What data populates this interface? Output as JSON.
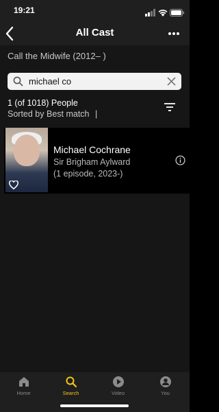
{
  "status": {
    "time": "19:21"
  },
  "header": {
    "title": "All Cast"
  },
  "show": {
    "title": "Call the Midwife (2012– )"
  },
  "search": {
    "value": "michael co"
  },
  "results": {
    "count_text": "1 (of 1018) People",
    "sort_text": "Sorted by Best match",
    "sort_separator": "|",
    "items": [
      {
        "name": "Michael Cochrane",
        "role": "Sir Brigham Aylward",
        "episodes": "(1 episode, 2023-)"
      }
    ]
  },
  "tabs": [
    {
      "label": "Home",
      "icon": "home-icon",
      "active": false
    },
    {
      "label": "Search",
      "icon": "search-icon",
      "active": true
    },
    {
      "label": "Video",
      "icon": "play-icon",
      "active": false
    },
    {
      "label": "You",
      "icon": "user-icon",
      "active": false
    }
  ],
  "colors": {
    "accent": "#f5c518",
    "background": "#000000",
    "bar": "#1f1f1f"
  }
}
